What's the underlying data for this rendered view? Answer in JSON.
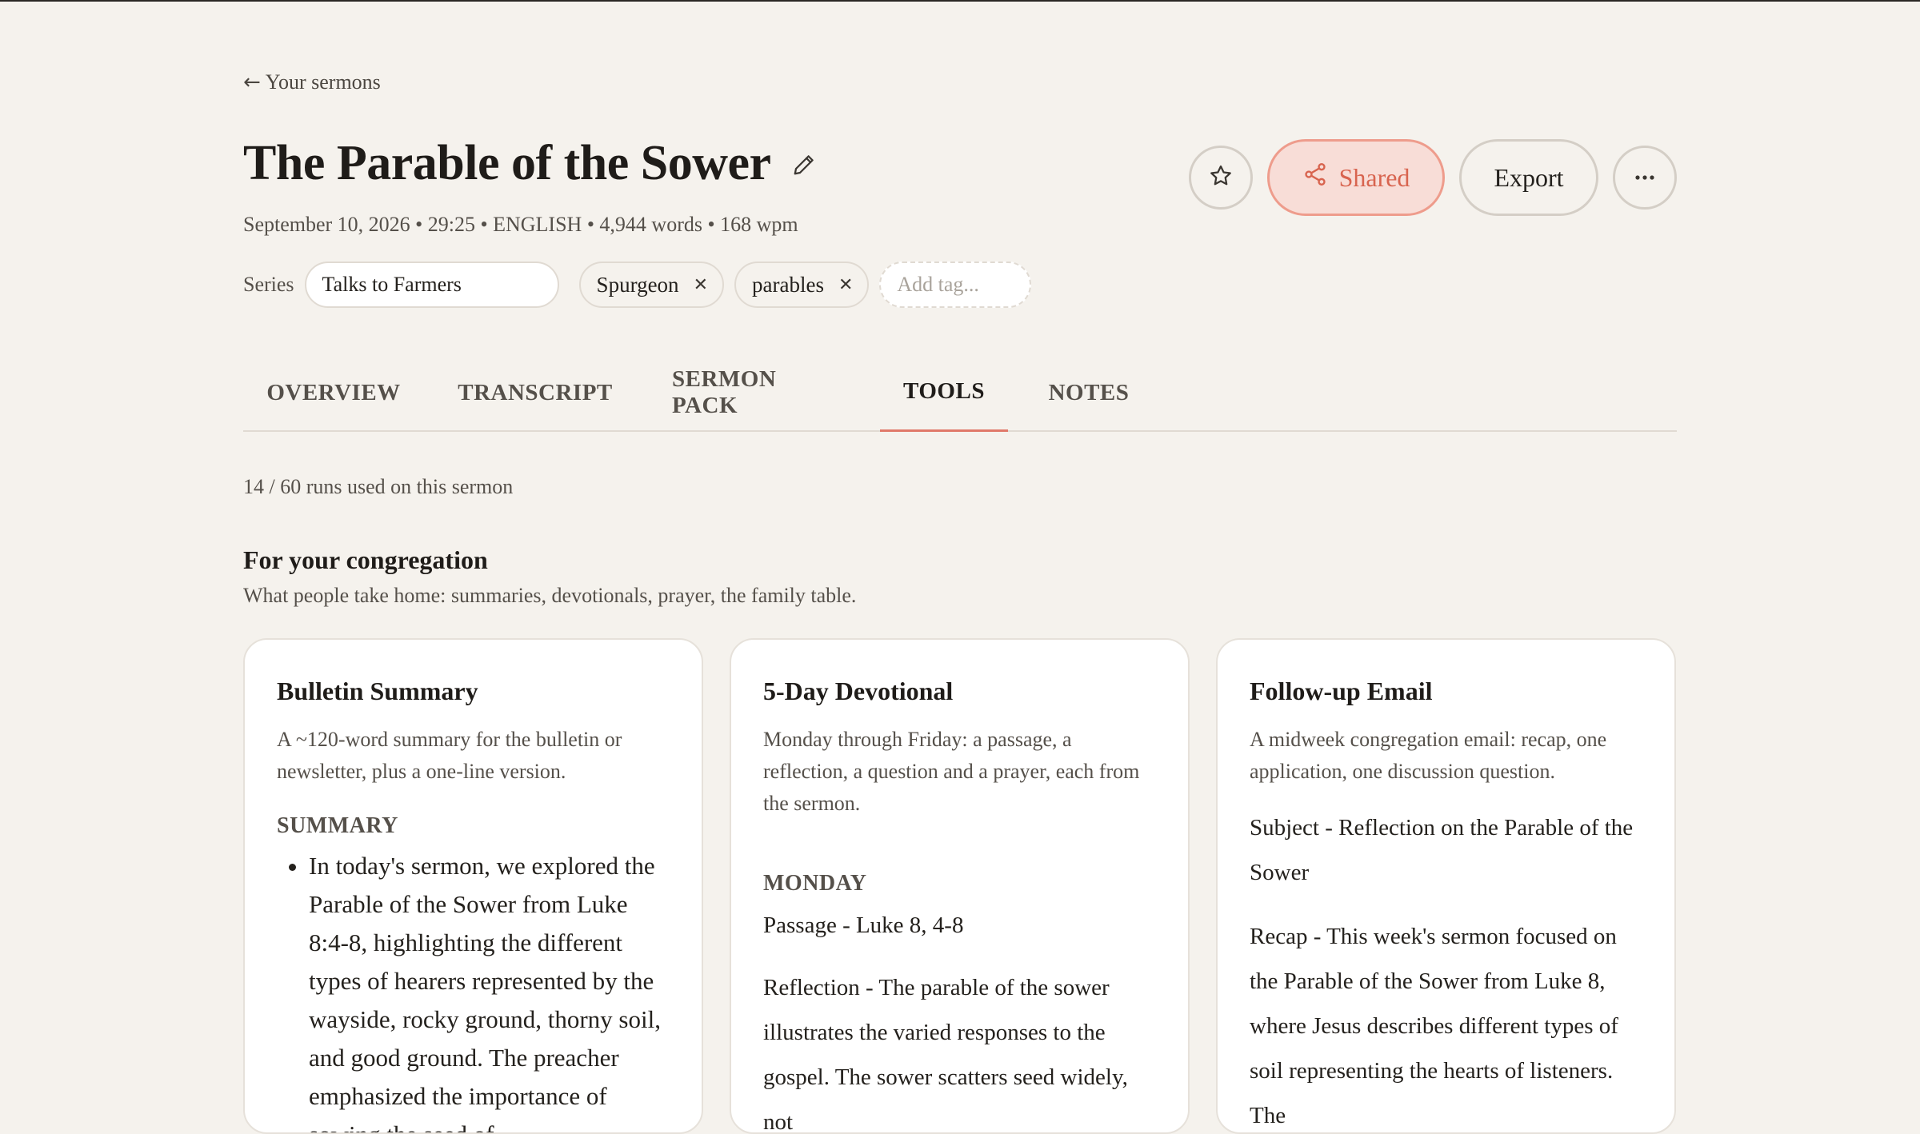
{
  "nav": {
    "back_arrow": "←",
    "back_label": "Your sermons"
  },
  "sermon": {
    "title": "The Parable of the Sower",
    "meta": "September 10, 2026 • 29:25 • ENGLISH • 4,944 words • 168 wpm",
    "series_label": "Series",
    "series_value": "Talks to Farmers",
    "tags": [
      {
        "label": "Spurgeon",
        "remove": "✕"
      },
      {
        "label": "parables",
        "remove": "✕"
      }
    ],
    "add_tag_placeholder": "Add tag..."
  },
  "actions": {
    "favorite_icon": "star-icon",
    "shared_label": "Shared",
    "shared_icon": "share-icon",
    "export_label": "Export",
    "more_icon": "more-icon"
  },
  "tabs": [
    {
      "label": "OVERVIEW",
      "active": false
    },
    {
      "label": "TRANSCRIPT",
      "active": false
    },
    {
      "label": "SERMON PACK",
      "active": false
    },
    {
      "label": "TOOLS",
      "active": true
    },
    {
      "label": "NOTES",
      "active": false
    }
  ],
  "usage": {
    "runs_text": "14 / 60 runs used on this sermon"
  },
  "section": {
    "title": "For your congregation",
    "subtitle": "What people take home: summaries, devotionals, prayer, the family table."
  },
  "cards": [
    {
      "title": "Bulletin Summary",
      "description": "A ~120-word summary for the bulletin or newsletter, plus a one-line version.",
      "label": "SUMMARY",
      "bullet": "In today's sermon, we explored the Parable of the Sower from Luke 8:4-8, highlighting the different types of hearers represented by the wayside, rocky ground, thorny soil, and good ground. The preacher emphasized the importance of sowing the seed of"
    },
    {
      "title": "5-Day Devotional",
      "description": "Monday through Friday: a passage, a reflection, a question and a prayer, each from the sermon.",
      "label": "MONDAY",
      "passage": "Passage - Luke 8, 4-8",
      "reflection": "Reflection - The parable of the sower illustrates the varied responses to the gospel. The sower scatters seed widely, not"
    },
    {
      "title": "Follow-up Email",
      "description": "A midweek congregation email: recap, one application, one discussion question.",
      "subject": "Subject - Reflection on the Parable of the Sower",
      "recap": "Recap - This week's sermon focused on the Parable of the Sower from Luke 8, where Jesus describes different types of soil representing the hearts of listeners. The"
    }
  ],
  "colors": {
    "background": "#f5f2ed",
    "accent": "#e0796a",
    "shared_text": "#d8644f",
    "shared_bg": "#f8ddd7"
  }
}
